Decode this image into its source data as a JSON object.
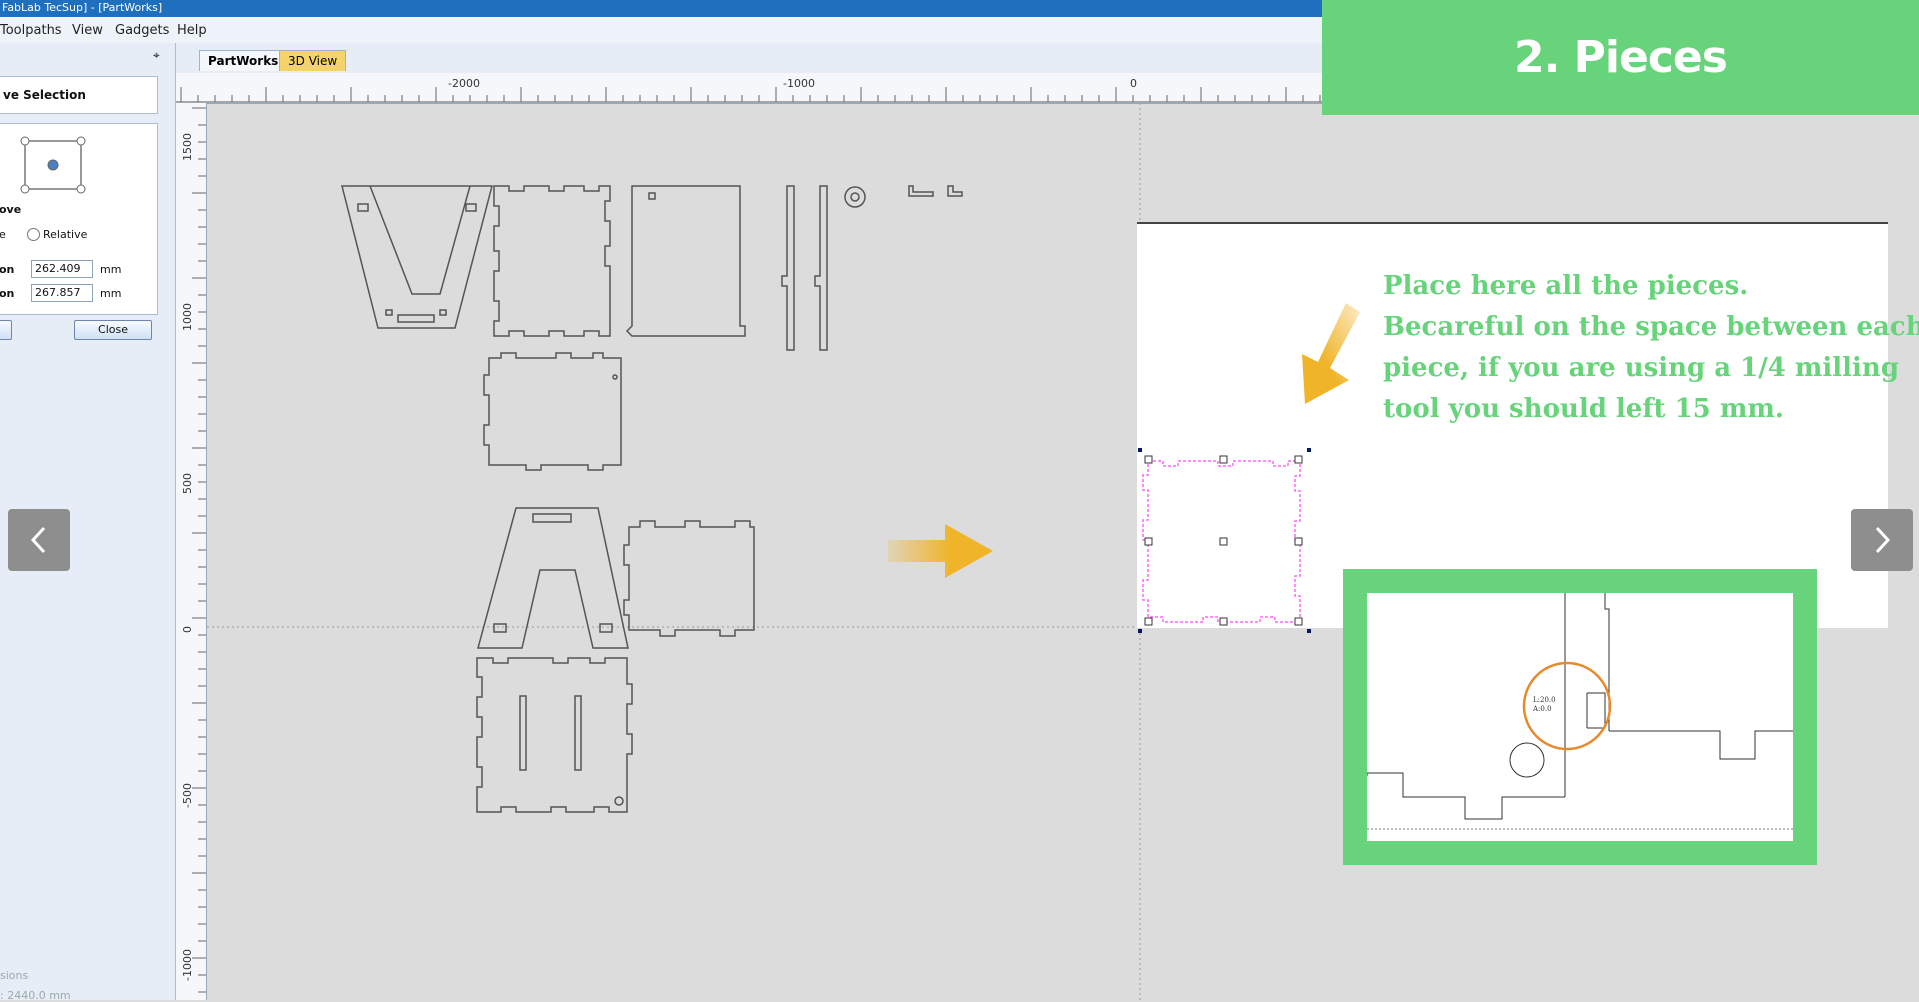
{
  "window": {
    "title": "FabLab TecSup] - [PartWorks]"
  },
  "menu": {
    "items": [
      "Toolpaths",
      "View",
      "Gadgets",
      "Help"
    ]
  },
  "left_panel": {
    "pin": "📌",
    "section_title": "ve Selection",
    "move_label": "ove",
    "absolute_label": "e",
    "relative_label": "Relative",
    "x_label": "on",
    "y_label": "on",
    "x_value": "262.409",
    "y_value": "267.857",
    "unit": "mm",
    "apply_label": "",
    "close_label": "Close",
    "footer_label": "sions",
    "footer_value": ": 2440.0 mm"
  },
  "tabs": [
    {
      "label": "PartWorks",
      "active": true
    },
    {
      "label": "3D View",
      "active": false
    }
  ],
  "rulers": {
    "horizontal": [
      "-2000",
      "-1000",
      "0"
    ],
    "vertical": [
      "1500",
      "1000",
      "500",
      "0",
      "-500",
      "-1000"
    ]
  },
  "banner": {
    "text": "2. Pieces"
  },
  "instruction": {
    "lines": [
      "Place here all the pieces.",
      "Becareful on the space between each",
      "piece, if you are using a 1/4 milling",
      "tool you should left 15 mm."
    ]
  },
  "inset": {
    "label_line1": "L:20.0",
    "label_line2": "A:0.0"
  },
  "colors": {
    "banner": "#67d37a",
    "accent_arrow": "#f0b429",
    "selection": "#ff66ff",
    "titlebar": "#1f6fbf"
  },
  "nav": {
    "prev_icon": "chevron-left-icon",
    "next_icon": "chevron-right-icon"
  }
}
